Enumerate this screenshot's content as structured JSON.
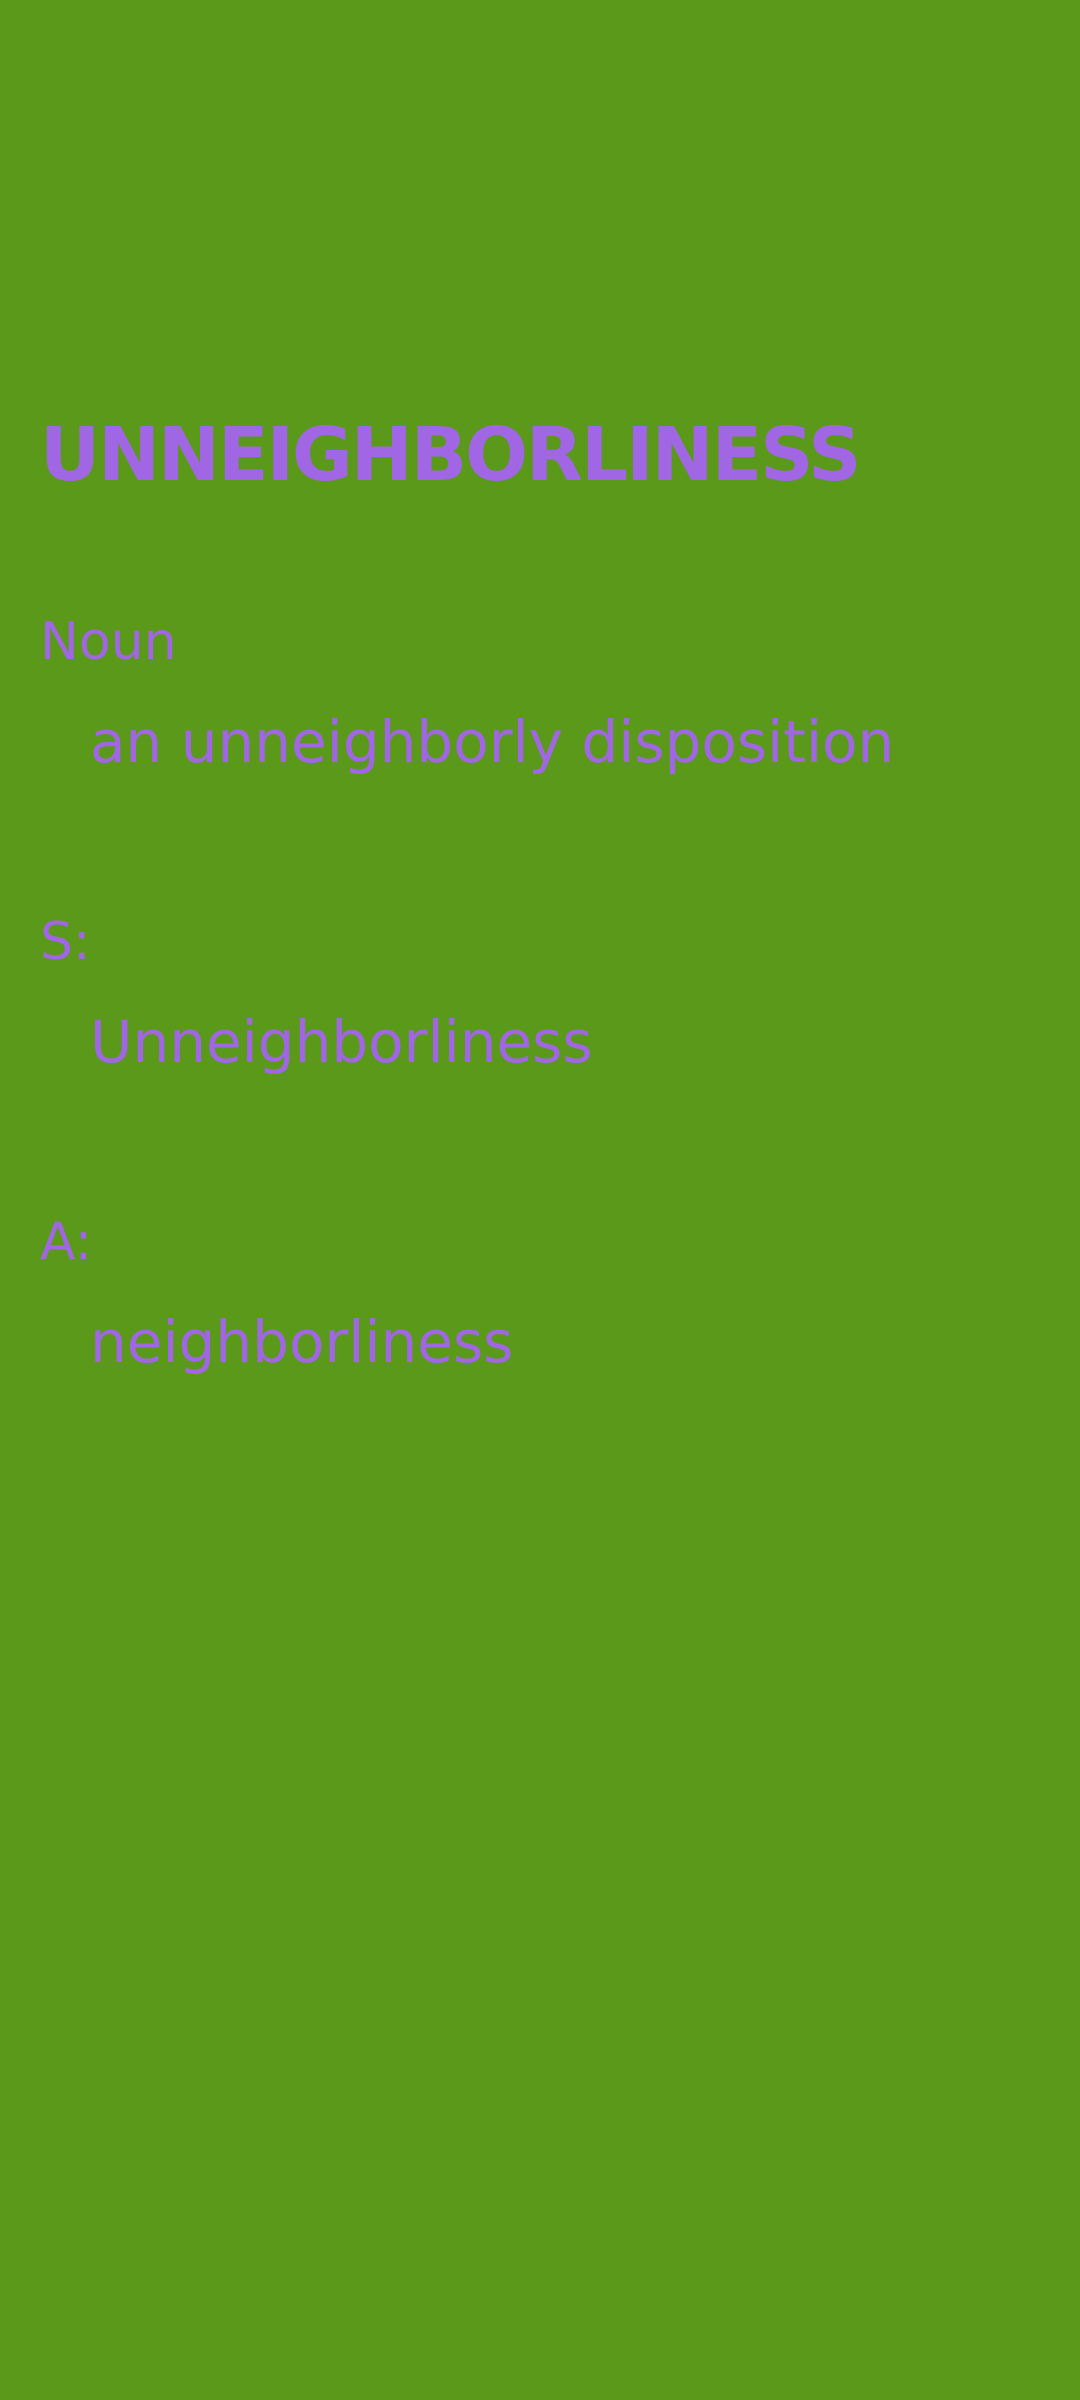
{
  "theme": {
    "background": "#5b991b",
    "text": "#a066e3"
  },
  "entry": {
    "word": "UNNEIGHBORLINESS",
    "part_of_speech": "Noun",
    "definition": "an unneighborly disposition",
    "synonym_label": "S:",
    "synonym": "Unneighborliness",
    "antonym_label": "A:",
    "antonym": "neighborliness"
  }
}
